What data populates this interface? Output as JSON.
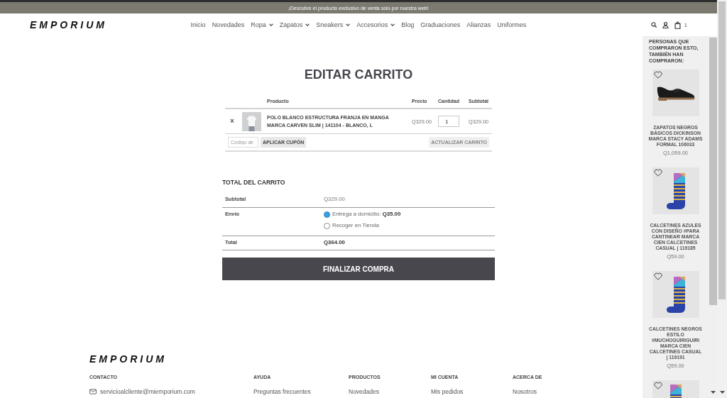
{
  "promo_bar": {
    "text": "¡Descubre el producto exclusivo de venta solo por nuestra web!"
  },
  "header": {
    "logo": "EMPORIUM",
    "nav": [
      {
        "label": "Inicio",
        "dropdown": false
      },
      {
        "label": "Novedades",
        "dropdown": false
      },
      {
        "label": "Ropa",
        "dropdown": true
      },
      {
        "label": "Zapatos",
        "dropdown": true
      },
      {
        "label": "Sneakers",
        "dropdown": true
      },
      {
        "label": "Accesorios",
        "dropdown": true
      },
      {
        "label": "Blog",
        "dropdown": false
      },
      {
        "label": "Graduaciones",
        "dropdown": false
      },
      {
        "label": "Alianzas",
        "dropdown": false
      },
      {
        "label": "Uniformes",
        "dropdown": false
      }
    ],
    "cart_count": "1"
  },
  "cart": {
    "title": "EDITAR CARRITO",
    "columns": [
      "Producto",
      "Precio",
      "Cantidad",
      "Subtotal"
    ],
    "items": [
      {
        "remove": "×",
        "name": "POLO BLANCO ESTRUCTURA FRANJA EN MANGA MARCA CARVEN SLIM | 141104 - BLANCO, L",
        "price": "Q329.00",
        "quantity": "1",
        "subtotal": "Q329.00"
      }
    ],
    "coupon": {
      "placeholder": "Código de",
      "button": "APLICAR CUPÓN"
    },
    "update_button": {
      "label": "ACTUALIZAR CARRITO",
      "disabled": true
    }
  },
  "totals": {
    "title": "TOTAL DEL CARRITO",
    "rows": [
      {
        "kind": "subtotal",
        "label": "Subtotal",
        "value": "Q329.00"
      },
      {
        "kind": "shipping",
        "label": "Envío",
        "options": [
          {
            "label": "Entrega a domicilio: **Q35.00**",
            "selected": true
          },
          {
            "label": "Recoger en Tienda",
            "selected": false
          }
        ]
      },
      {
        "kind": "total",
        "label": "Total",
        "value": "Q364.00"
      }
    ],
    "checkout_button": "FINALIZAR COMPRA"
  },
  "sidebar": {
    "title": "PERSONAS QUE COMPRARON ESTO, TAMBIÉN HAN COMPRARON:",
    "products": [
      {
        "kind": "shoe",
        "wishlisted": false,
        "name": "ZAPATOS NEGROS BÁSICOS DICKINSON MARCA STACY ADAMS FORMAL 106033",
        "price": "Q1,059.00"
      },
      {
        "kind": "socks",
        "wishlisted": false,
        "name": "CALCETINES AZULES CON DISEÑO #PARA CANTINEAR MARCA CIEN CALCETINES CASUAL | 119185",
        "price": "Q59.00"
      },
      {
        "kind": "socks",
        "wishlisted": false,
        "name": "CALCETINES NEGROS ESTILO #MUCHOGUIRIGUIRI MARCA CIEN CALCETINES CASUAL | 119191",
        "price": "Q59.00"
      },
      {
        "kind": "socks",
        "wishlisted": false
      }
    ]
  },
  "footer": {
    "logo": "EMPORIUM",
    "columns": [
      {
        "heading": "CONTACTO",
        "links": [
          {
            "kind": "email",
            "label": "servicioalcliente@miemporium.com"
          }
        ]
      },
      {
        "heading": "AYUDA",
        "links": [
          {
            "kind": "link",
            "label": "Preguntas frecuentes"
          }
        ]
      },
      {
        "heading": "PRODUCTOS",
        "links": [
          {
            "kind": "link",
            "label": "Novedades"
          }
        ]
      },
      {
        "heading": "MI CUENTA",
        "links": [
          {
            "kind": "link",
            "label": "Mis pedidos"
          }
        ]
      },
      {
        "heading": "ACERCA DE",
        "links": [
          {
            "kind": "link",
            "label": "Nosotros"
          }
        ]
      }
    ]
  }
}
